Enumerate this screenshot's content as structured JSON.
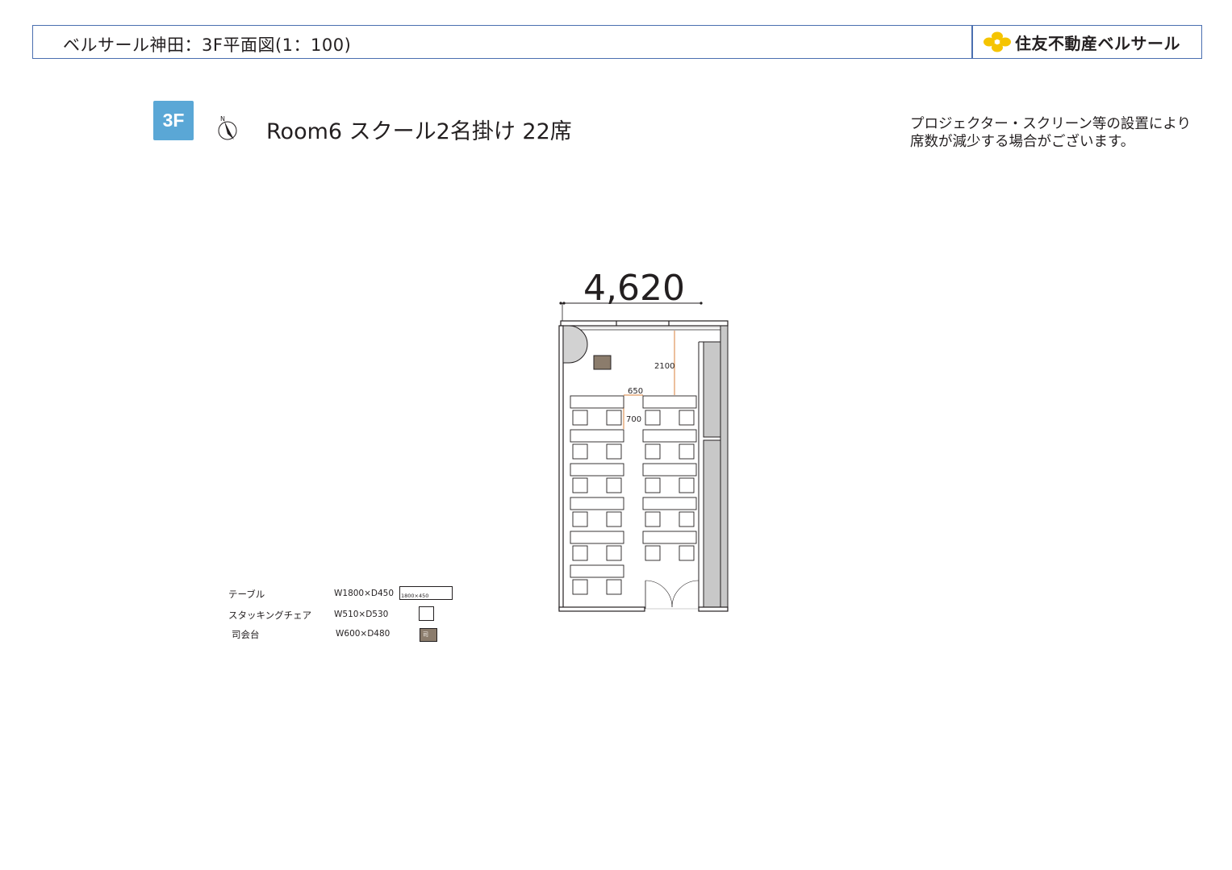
{
  "header": {
    "title": "ベルサール神田：3F平面図(1：100)",
    "brand": "住友不動産ベルサール"
  },
  "floor_badge": "3F",
  "north_label": "N",
  "room_title": "Room6 スクール2名掛け 22席",
  "note": {
    "line1": "プロジェクター・スクリーン等の設置により",
    "line2": "席数が減少する場合がございます。"
  },
  "plan": {
    "width_dim": "4,620",
    "dim_2100": "2100",
    "dim_650": "650",
    "dim_700": "700",
    "seat_count": 22,
    "tables_per_column": 6,
    "columns": 2
  },
  "legend": [
    {
      "label": "テーブル",
      "spec": "W1800×D450",
      "swatch_text": "1800×450",
      "swatch": "table"
    },
    {
      "label": "スタッキングチェア",
      "spec": "W510×D530",
      "swatch_text": "",
      "swatch": "chair"
    },
    {
      "label": "司会台",
      "spec": "W600×D480",
      "swatch_text": "司",
      "swatch": "podium"
    }
  ],
  "colors": {
    "frame_blue": "#4a6fb0",
    "badge_blue": "#5aa7d6",
    "brand_yellow": "#f5c400",
    "podium_brown": "#8b7c6c",
    "wall_gray": "#c8c8c8",
    "dim_orange": "#d9803b"
  }
}
